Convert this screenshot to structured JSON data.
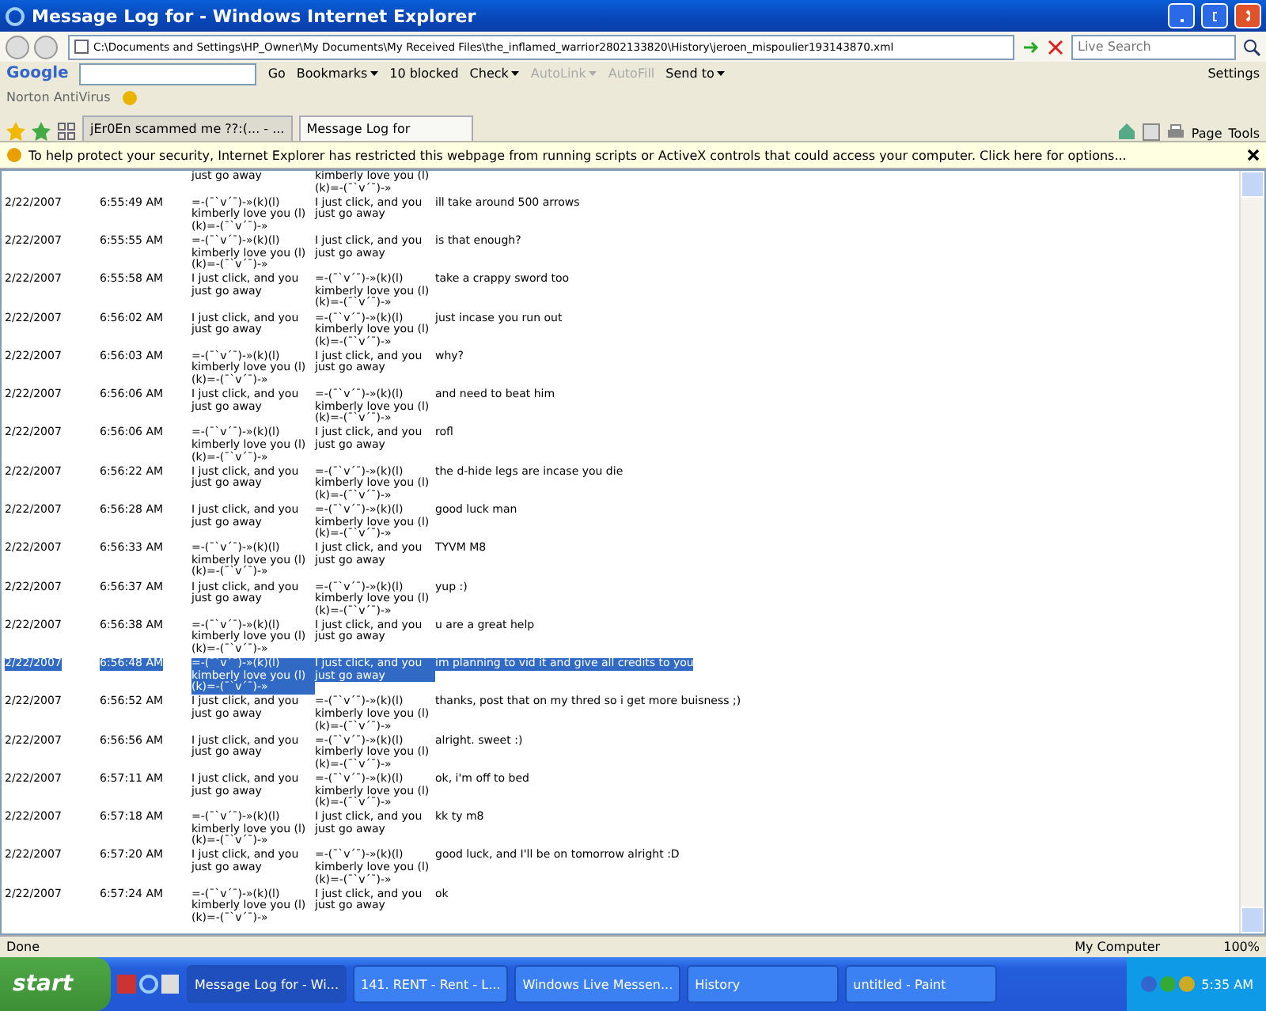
{
  "window": {
    "title": "Message Log for - Windows Internet Explorer"
  },
  "address_bar": {
    "url": "C:\\Documents and Settings\\HP_Owner\\My Documents\\My Received Files\\the_inflamed_warrior2802133820\\History\\jeroen_mispoulier193143870.xml",
    "search_placeholder": "Live Search"
  },
  "google_toolbar": {
    "logo": "Google",
    "items": [
      {
        "label": "Go",
        "kind": "plain",
        "disabled": false
      },
      {
        "label": "Bookmarks",
        "kind": "menu",
        "disabled": false
      },
      {
        "label": "10 blocked",
        "kind": "plain",
        "disabled": false
      },
      {
        "label": "Check",
        "kind": "menu",
        "disabled": false
      },
      {
        "label": "AutoLink",
        "kind": "menu",
        "disabled": true
      },
      {
        "label": "AutoFill",
        "kind": "plain",
        "disabled": true
      },
      {
        "label": "Send to",
        "kind": "menu",
        "disabled": false
      }
    ],
    "settings": "Settings"
  },
  "norton": {
    "label": "Norton AntiVirus"
  },
  "tabs": [
    {
      "label": "jEr0En scammed me ??:(... - ...",
      "selected": false
    },
    {
      "label": "Message Log for",
      "selected": true
    }
  ],
  "command_bar": {
    "items": [
      "Page",
      "Tools"
    ]
  },
  "info_bar": {
    "text": "To help protect your security, Internet Explorer has restricted this webpage from running scripts or ActiveX controls that could access your computer. Click here for options..."
  },
  "log": {
    "partial_row": {
      "from": "just go away",
      "to": "kimberly love you (l) (k)=-(¯`v´¯)-»"
    },
    "rows": [
      {
        "date": "2/22/2007",
        "time": "6:55:49 AM",
        "from": "=-(¯`v´¯)-»(k)(l) kimberly love you (l) (k)=-(¯`v´¯)-»",
        "to": "I just click, and you just go away",
        "message": "ill take around 500 arrows",
        "selected": false
      },
      {
        "date": "2/22/2007",
        "time": "6:55:55 AM",
        "from": "=-(¯`v´¯)-»(k)(l) kimberly love you (l) (k)=-(¯`v´¯)-»",
        "to": "I just click, and you just go away",
        "message": "is that enough?",
        "selected": false
      },
      {
        "date": "2/22/2007",
        "time": "6:55:58 AM",
        "from": "I just click, and you just go away",
        "to": "=-(¯`v´¯)-»(k)(l) kimberly love you (l) (k)=-(¯`v´¯)-»",
        "message": "take a crappy sword too",
        "selected": false
      },
      {
        "date": "2/22/2007",
        "time": "6:56:02 AM",
        "from": "I just click, and you just go away",
        "to": "=-(¯`v´¯)-»(k)(l) kimberly love you (l) (k)=-(¯`v´¯)-»",
        "message": "just incase you run out",
        "selected": false
      },
      {
        "date": "2/22/2007",
        "time": "6:56:03 AM",
        "from": "=-(¯`v´¯)-»(k)(l) kimberly love you (l) (k)=-(¯`v´¯)-»",
        "to": "I just click, and you just go away",
        "message": "why?",
        "selected": false
      },
      {
        "date": "2/22/2007",
        "time": "6:56:06 AM",
        "from": "I just click, and you just go away",
        "to": "=-(¯`v´¯)-»(k)(l) kimberly love you (l) (k)=-(¯`v´¯)-»",
        "message": "and need to beat him",
        "selected": false
      },
      {
        "date": "2/22/2007",
        "time": "6:56:06 AM",
        "from": "=-(¯`v´¯)-»(k)(l) kimberly love you (l) (k)=-(¯`v´¯)-»",
        "to": "I just click, and you just go away",
        "message": "rofl",
        "selected": false
      },
      {
        "date": "2/22/2007",
        "time": "6:56:22 AM",
        "from": "I just click, and you just go away",
        "to": "=-(¯`v´¯)-»(k)(l) kimberly love you (l) (k)=-(¯`v´¯)-»",
        "message": "the d-hide legs are incase you die",
        "selected": false
      },
      {
        "date": "2/22/2007",
        "time": "6:56:28 AM",
        "from": "I just click, and you just go away",
        "to": "=-(¯`v´¯)-»(k)(l) kimberly love you (l) (k)=-(¯`v´¯)-»",
        "message": "good luck man",
        "selected": false
      },
      {
        "date": "2/22/2007",
        "time": "6:56:33 AM",
        "from": "=-(¯`v´¯)-»(k)(l) kimberly love you (l) (k)=-(¯`v´¯)-»",
        "to": "I just click, and you just go away",
        "message": "TYVM M8",
        "selected": false
      },
      {
        "date": "2/22/2007",
        "time": "6:56:37 AM",
        "from": "I just click, and you just go away",
        "to": "=-(¯`v´¯)-»(k)(l) kimberly love you (l) (k)=-(¯`v´¯)-»",
        "message": "yup :)",
        "selected": false
      },
      {
        "date": "2/22/2007",
        "time": "6:56:38 AM",
        "from": "=-(¯`v´¯)-»(k)(l) kimberly love you (l) (k)=-(¯`v´¯)-»",
        "to": "I just click, and you just go away",
        "message": "u are a great help",
        "selected": false
      },
      {
        "date": "2/22/2007",
        "time": "6:56:48 AM",
        "from": "=-(¯`v´¯)-»(k)(l) kimberly love you (l) (k)=-(¯`v´¯)-»",
        "to": "I just click, and you just go away",
        "message": "im planning to vid it and give all credits to you",
        "selected": true
      },
      {
        "date": "2/22/2007",
        "time": "6:56:52 AM",
        "from": "I just click, and you just go away",
        "to": "=-(¯`v´¯)-»(k)(l) kimberly love you (l) (k)=-(¯`v´¯)-»",
        "message": "thanks, post that on my thred so i get more buisness ;)",
        "selected": false
      },
      {
        "date": "2/22/2007",
        "time": "6:56:56 AM",
        "from": "I just click, and you just go away",
        "to": "=-(¯`v´¯)-»(k)(l) kimberly love you (l) (k)=-(¯`v´¯)-»",
        "message": "alright. sweet :)",
        "selected": false
      },
      {
        "date": "2/22/2007",
        "time": "6:57:11 AM",
        "from": "I just click, and you just go away",
        "to": "=-(¯`v´¯)-»(k)(l) kimberly love you (l) (k)=-(¯`v´¯)-»",
        "message": "ok, i'm off to bed",
        "selected": false
      },
      {
        "date": "2/22/2007",
        "time": "6:57:18 AM",
        "from": "=-(¯`v´¯)-»(k)(l) kimberly love you (l) (k)=-(¯`v´¯)-»",
        "to": "I just click, and you just go away",
        "message": "kk ty m8",
        "selected": false
      },
      {
        "date": "2/22/2007",
        "time": "6:57:20 AM",
        "from": "I just click, and you just go away",
        "to": "=-(¯`v´¯)-»(k)(l) kimberly love you (l) (k)=-(¯`v´¯)-»",
        "message": "good luck, and I'll be on tomorrow alright :D",
        "selected": false
      },
      {
        "date": "2/22/2007",
        "time": "6:57:24 AM",
        "from": "=-(¯`v´¯)-»(k)(l) kimberly love you (l) (k)=-(¯`v´¯)-»",
        "to": "I just click, and you just go away",
        "message": "ok",
        "selected": false
      }
    ]
  },
  "status_bar": {
    "status": "Done",
    "zone": "My Computer",
    "zoom": "100%"
  },
  "taskbar": {
    "start": "start",
    "buttons": [
      {
        "label": "Message Log for - Wi...",
        "selected": true
      },
      {
        "label": "141. RENT - Rent - L...",
        "selected": false
      },
      {
        "label": "Windows Live Messen...",
        "selected": false
      },
      {
        "label": "History",
        "selected": false
      },
      {
        "label": "untitled - Paint",
        "selected": false
      }
    ],
    "clock": "5:35 AM"
  }
}
